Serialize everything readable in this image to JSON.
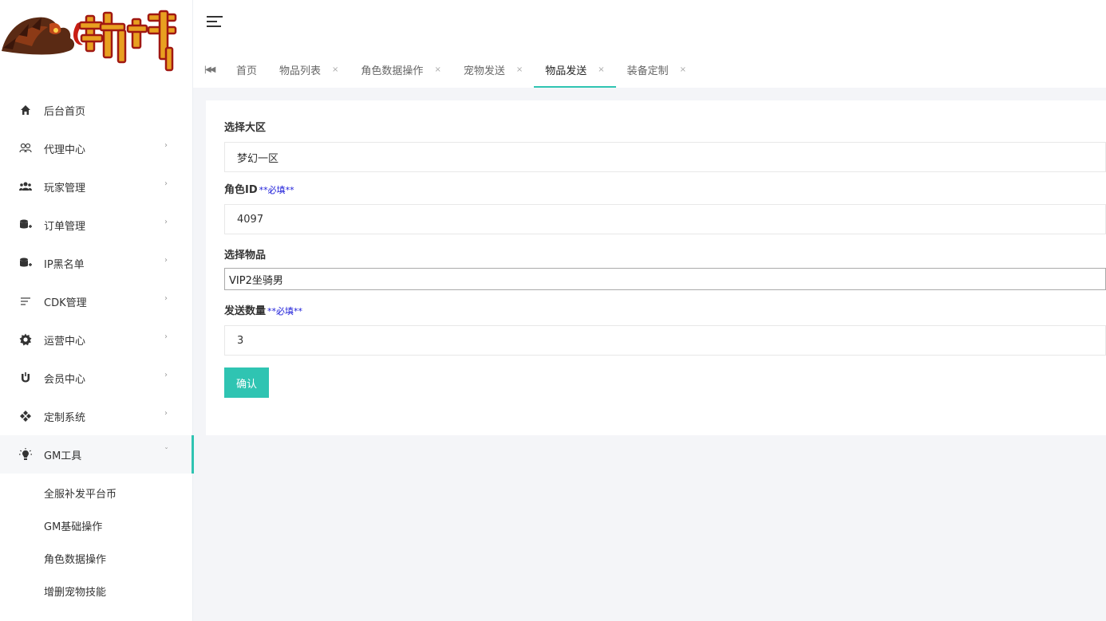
{
  "brand": {
    "logo_text": "封神"
  },
  "sidebar": {
    "items": [
      {
        "label": "后台首页",
        "icon": "home-icon",
        "has_arrow": false
      },
      {
        "label": "代理中心",
        "icon": "agents-icon",
        "has_arrow": true
      },
      {
        "label": "玩家管理",
        "icon": "users-icon",
        "has_arrow": true
      },
      {
        "label": "订单管理",
        "icon": "database-icon",
        "has_arrow": true
      },
      {
        "label": "IP黑名单",
        "icon": "database-icon",
        "has_arrow": true
      },
      {
        "label": "CDK管理",
        "icon": "list-icon",
        "has_arrow": true
      },
      {
        "label": "运营中心",
        "icon": "gear-icon",
        "has_arrow": true
      },
      {
        "label": "会员中心",
        "icon": "magnet-icon",
        "has_arrow": true
      },
      {
        "label": "定制系统",
        "icon": "diamond-icon",
        "has_arrow": true
      },
      {
        "label": "GM工具",
        "icon": "bulb-icon",
        "has_arrow": true,
        "open": true
      }
    ],
    "submenu": [
      {
        "label": "全服补发平台币"
      },
      {
        "label": "GM基础操作"
      },
      {
        "label": "角色数据操作"
      },
      {
        "label": "增删宠物技能"
      }
    ]
  },
  "tabs": [
    {
      "label": "首页",
      "closable": false,
      "active": false
    },
    {
      "label": "物品列表",
      "closable": true,
      "active": false
    },
    {
      "label": "角色数据操作",
      "closable": true,
      "active": false
    },
    {
      "label": "宠物发送",
      "closable": true,
      "active": false
    },
    {
      "label": "物品发送",
      "closable": true,
      "active": true
    },
    {
      "label": "装备定制",
      "closable": true,
      "active": false
    }
  ],
  "form": {
    "region": {
      "label": "选择大区",
      "value": "梦幻一区"
    },
    "role_id": {
      "label": "角色ID",
      "required": "**必填**",
      "value": "4097"
    },
    "item": {
      "label": "选择物品",
      "value": "VIP2坐骑男"
    },
    "quantity": {
      "label": "发送数量",
      "required": "**必填**",
      "value": "3"
    },
    "confirm_label": "确认"
  },
  "colors": {
    "accent": "#2fc4b2",
    "required": "#1a1ad8"
  }
}
